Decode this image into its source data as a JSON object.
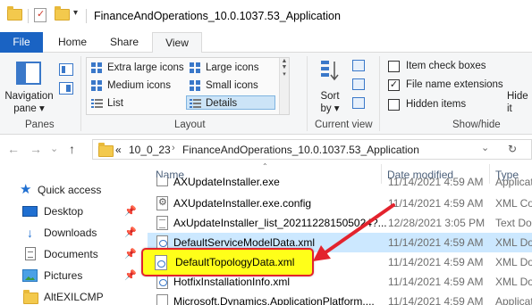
{
  "window": {
    "title": "FinanceAndOperations_10.0.1037.53_Application",
    "qa_dropdown": "▾"
  },
  "ribbon_tabs": [
    "File",
    "Home",
    "Share",
    "View"
  ],
  "ribbon": {
    "panes": {
      "navigation_pane_label_1": "Navigation",
      "navigation_pane_label_2": "pane ▾",
      "group_label": "Panes"
    },
    "layout": {
      "items": [
        "Extra large icons",
        "Large icons",
        "Medium icons",
        "Small icons",
        "List",
        "Details"
      ],
      "selected": "Details",
      "group_label": "Layout"
    },
    "current_view": {
      "sort_label_1": "Sort",
      "sort_label_2": "by ▾",
      "group_label": "Current view"
    },
    "show_hide": {
      "checkboxes": [
        {
          "label": "Item check boxes",
          "checked": false
        },
        {
          "label": "File name extensions",
          "checked": true
        },
        {
          "label": "Hidden items",
          "checked": false
        }
      ],
      "hide_label_1": "Hide",
      "hide_label_2": "it",
      "group_label": "Show/hide"
    }
  },
  "address_bar": {
    "prefix": "«",
    "crumbs": [
      "10_0_23",
      "FinanceAndOperations_10.0.1037.53_Application"
    ],
    "separator": "›",
    "dropdown": "⌄",
    "refresh": "↻"
  },
  "navigation": {
    "back": "←",
    "forward": "→",
    "down": "⌄",
    "up": "↑",
    "items": [
      {
        "label": "Quick access",
        "icon": "star-icon",
        "pinned": false
      },
      {
        "label": "Desktop",
        "icon": "desktop-icon",
        "pinned": true
      },
      {
        "label": "Downloads",
        "icon": "download-icon",
        "pinned": true
      },
      {
        "label": "Documents",
        "icon": "document-icon",
        "pinned": true
      },
      {
        "label": "Pictures",
        "icon": "pictures-icon",
        "pinned": true
      },
      {
        "label": "AltEXILCMP",
        "icon": "folder-icon",
        "pinned": false
      }
    ]
  },
  "columns": {
    "name": "Name",
    "date_modified": "Date modified",
    "type": "Type"
  },
  "files": [
    {
      "name": "AXUpdateInstaller.exe",
      "date": "11/14/2021 4:59 AM",
      "type": "Applicati",
      "icon": "exe-icon"
    },
    {
      "name": "AXUpdateInstaller.exe.config",
      "date": "11/14/2021 4:59 AM",
      "type": "XML Co",
      "icon": "config-icon"
    },
    {
      "name": "AxUpdateInstaller_list_202112281505024?...",
      "date": "12/28/2021 3:05 PM",
      "type": "Text Do",
      "icon": "text-file-icon"
    },
    {
      "name": "DefaultServiceModelData.xml",
      "date": "11/14/2021 4:59 AM",
      "type": "XML Do",
      "icon": "xml-file-icon",
      "selected": true
    },
    {
      "name": "DefaultTopologyData.xml",
      "date": "11/14/2021 4:59 AM",
      "type": "XML Do",
      "icon": "xml-file-icon",
      "highlighted": true
    },
    {
      "name": "HotfixInstallationInfo.xml",
      "date": "11/14/2021 4:59 AM",
      "type": "XML Do",
      "icon": "xml-file-icon"
    },
    {
      "name": "Microsoft.Dynamics.ApplicationPlatform....",
      "date": "11/14/2021 4:59 AM",
      "type": "Applicat",
      "icon": "exe-icon"
    }
  ],
  "colors": {
    "file_tab": "#1a63c3",
    "highlight_fill": "#ffff19",
    "highlight_border": "#e3232d",
    "arrow": "#e3232d",
    "selected_row": "#cce8ff"
  }
}
